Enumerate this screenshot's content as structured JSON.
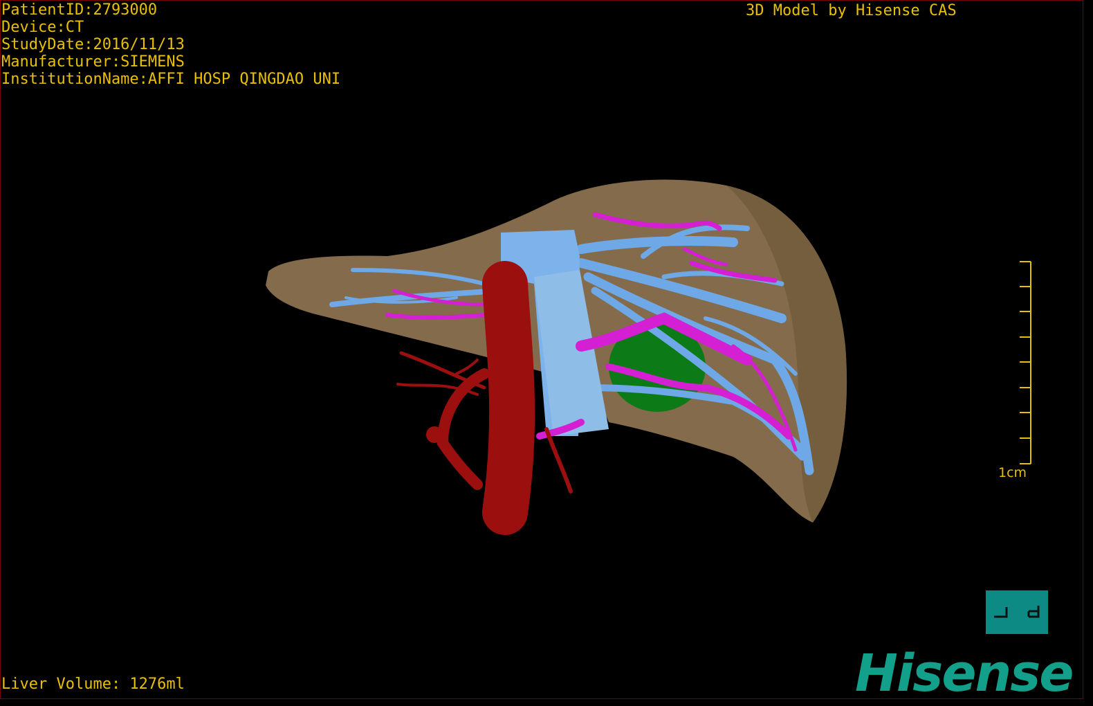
{
  "patient_info": {
    "patient_id": "PatientID:2793000",
    "device": "Device:CT",
    "study_date": "StudyDate:2016/11/13",
    "manufacturer": "Manufacturer:SIEMENS",
    "institution": "InstitutionName:AFFI HOSP QINGDAO UNI"
  },
  "model_credit": "3D Model by Hisense CAS",
  "liver_volume": "Liver Volume: 1276ml",
  "scale_bar": {
    "label": "1cm"
  },
  "orientation_cube": {
    "label": "orientation-indicator"
  },
  "brand": {
    "name": "Hisense",
    "color": "#13a08a"
  },
  "colors": {
    "overlay_text": "#e8c000",
    "liver": "#8a7150",
    "hepatic_vein": "#6fa8e6",
    "portal_vein": "#d41fd2",
    "artery_ivc": "#9c0f0f",
    "gallbladder": "#0d7a18",
    "background": "#000000"
  }
}
